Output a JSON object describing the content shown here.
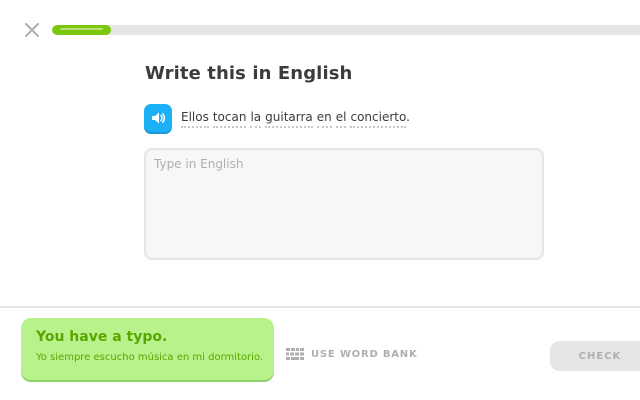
{
  "header": {
    "close_icon": "close-icon",
    "progress": 0.1
  },
  "main": {
    "title": "Write this in English",
    "speaker_icon": "speaker-icon",
    "sentence_words": [
      "Ellos",
      "tocan",
      "la",
      "guitarra",
      "en",
      "el",
      "concierto"
    ],
    "sentence_end": ".",
    "answer_placeholder": "Type in English",
    "answer_value": ""
  },
  "footer": {
    "feedback_title": "You have a typo.",
    "feedback_text": "Yo siempre escucho música en mi dormitorio.",
    "word_bank_icon": "keyboard-icon",
    "word_bank_label": "USE WORD BANK",
    "check_label": "CHECK"
  },
  "colors": {
    "progress_fill": "#7ac70c",
    "speaker_button": "#1cb0f6",
    "feedback_background": "#b8f28b",
    "feedback_text": "#58a700",
    "disabled_button": "#e5e5e5"
  }
}
